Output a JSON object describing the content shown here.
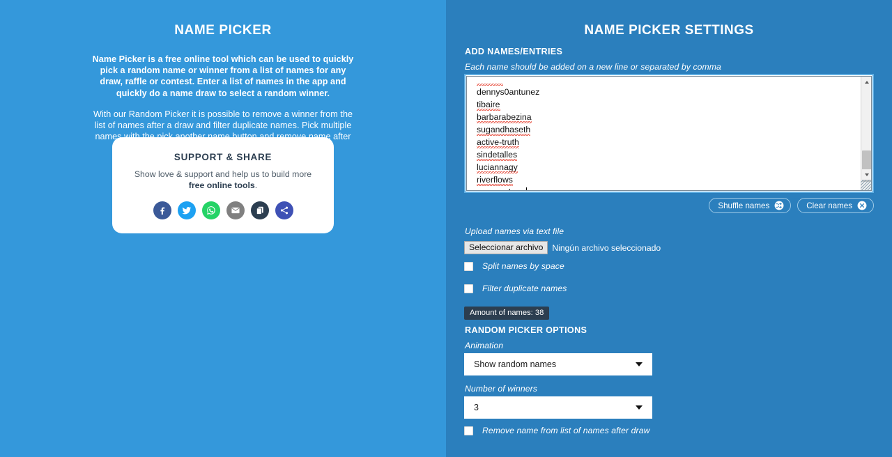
{
  "colors": {
    "left_panel_bg": "#3498db",
    "right_panel_bg": "#2b7fbd",
    "badge_bg": "#2c3e50",
    "facebook": "#3b5998",
    "twitter": "#1da1f2",
    "whatsapp": "#25d366",
    "email": "#808080",
    "copy": "#2c3e50",
    "share": "#3f51b5"
  },
  "left": {
    "title": "NAME PICKER",
    "paragraph_1": "Name Picker is a free online tool which can be used to quickly pick a random name or winner from a list of names for any draw, raffle or contest. Enter a list of names in the app and quickly do a name draw to select a random winner.",
    "paragraph_2": "With our Random Picker it is possible to remove a winner from the list of names after a draw and filter duplicate names. Pick multiple names with the pick another name button and remove name after the name raffle.",
    "support_card": {
      "title": "SUPPORT & SHARE",
      "subtitle_prefix": "Show love & support and help us to build more ",
      "subtitle_bold": "free online tools",
      "subtitle_suffix": ".",
      "share_buttons": [
        {
          "name": "facebook-share-icon",
          "label": "Facebook"
        },
        {
          "name": "twitter-share-icon",
          "label": "Twitter"
        },
        {
          "name": "whatsapp-share-icon",
          "label": "WhatsApp"
        },
        {
          "name": "email-share-icon",
          "label": "Email"
        },
        {
          "name": "copy-link-icon",
          "label": "Copy link"
        },
        {
          "name": "share-icon",
          "label": "Share"
        }
      ]
    }
  },
  "right": {
    "title": "NAME PICKER SETTINGS",
    "add_names": {
      "heading": "ADD NAMES/ENTRIES",
      "hint": "Each name should be added on a new line or separated by comma",
      "names": [
        "dennys0antunez",
        "tibaire",
        "barbarabezina",
        "sugandhaseth",
        "active-truth",
        "sindetalles",
        "luciannagy",
        "riverflows",
        "reverendrum"
      ]
    },
    "buttons": {
      "shuffle_label": "Shuffle names",
      "clear_label": "Clear names"
    },
    "upload": {
      "label": "Upload names via text file",
      "select_button": "Seleccionar archivo",
      "status": "Ningún archivo seleccionado"
    },
    "options": {
      "split_by_space": "Split names by space",
      "filter_duplicates": "Filter duplicate names",
      "remove_after_draw": "Remove name from list of names after draw"
    },
    "names_count_badge": "Amount of names: 38",
    "picker_options": {
      "heading": "RANDOM PICKER OPTIONS",
      "animation_label": "Animation",
      "animation_value": "Show random names",
      "winners_label": "Number of winners",
      "winners_value": "3"
    }
  }
}
